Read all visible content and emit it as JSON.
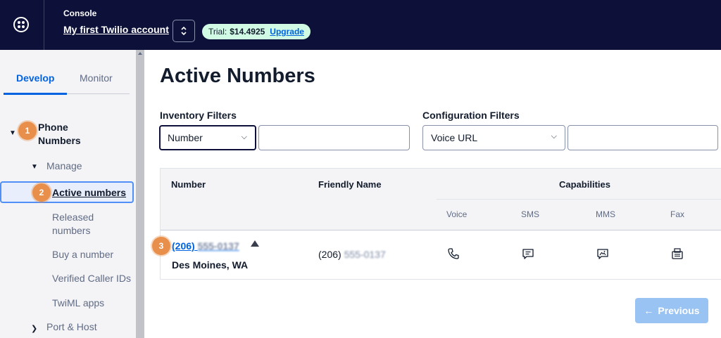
{
  "topbar": {
    "console_label": "Console",
    "account_name": "My first Twilio account",
    "trial_label": "Trial:",
    "trial_balance": "$14.4925",
    "upgrade_label": "Upgrade"
  },
  "sidebar": {
    "tabs": [
      {
        "label": "Develop",
        "active": true
      },
      {
        "label": "Monitor",
        "active": false
      }
    ],
    "phone_numbers": "Phone Numbers",
    "manage": "Manage",
    "active_numbers": "Active numbers",
    "released_numbers": "Released numbers",
    "buy_number": "Buy a number",
    "verified_caller_ids": "Verified Caller IDs",
    "twiml_apps": "TwiML apps",
    "port_host": "Port & Host"
  },
  "badges": [
    "1",
    "2",
    "3"
  ],
  "main": {
    "title": "Active Numbers",
    "inventory_filters_label": "Inventory Filters",
    "inventory_select_value": "Number",
    "configuration_filters_label": "Configuration Filters",
    "configuration_select_value": "Voice URL"
  },
  "table": {
    "headers": {
      "number": "Number",
      "friendly_name": "Friendly Name",
      "capabilities": "Capabilities",
      "voice": "Voice",
      "sms": "SMS",
      "mms": "MMS",
      "fax": "Fax"
    },
    "rows": [
      {
        "number_prefix": "(206)",
        "number_hidden": "555-0137",
        "location": "Des Moines, WA",
        "friendly_prefix": "(206)",
        "friendly_hidden": "555-0137",
        "capability_icons": [
          "phone-icon",
          "sms-icon",
          "mms-icon",
          "fax-icon"
        ]
      }
    ]
  },
  "pagination": {
    "previous_label": "Previous"
  },
  "colors": {
    "topbar_bg": "#0d1139",
    "link_blue": "#0263e0",
    "badge_orange": "#e8904b",
    "trial_pill_bg": "#d1fae5",
    "previous_button_bg": "#99c3f2"
  }
}
